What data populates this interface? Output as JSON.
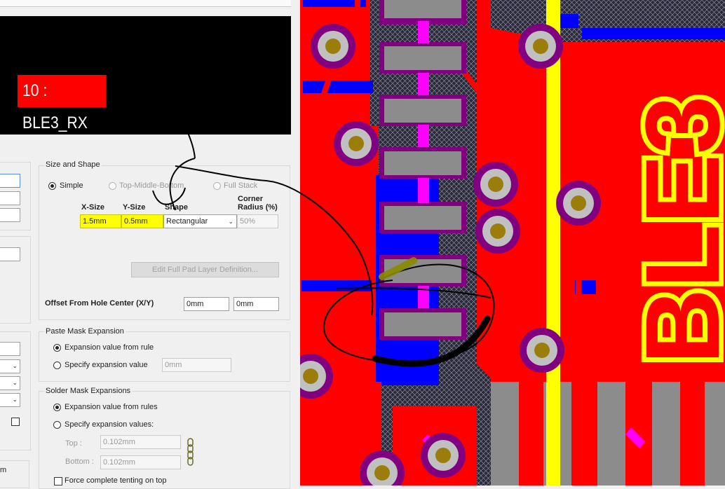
{
  "preview": {
    "pad_label": "10 : BLE3_RX"
  },
  "size_shape": {
    "title": "Size and Shape",
    "mode_simple": "Simple",
    "mode_tmb": "Top-Middle-Bottom",
    "mode_full": "Full Stack",
    "col_x": "X-Size",
    "col_y": "Y-Size",
    "col_shape": "Shape",
    "col_corner_1": "Corner",
    "col_corner_2": "Radius (%)",
    "x_size": "1.5mm",
    "y_size": "0.5mm",
    "shape": "Rectangular",
    "corner_radius": "50%",
    "edit_button": "Edit Full Pad Layer Definition...",
    "offset_label": "Offset From Hole Center (X/Y)",
    "offset_x": "0mm",
    "offset_y": "0mm"
  },
  "paste_mask": {
    "title": "Paste Mask Expansion",
    "opt_rule": "Expansion value from rule",
    "opt_specify": "Specify expansion value",
    "value": "0mm"
  },
  "solder_mask": {
    "title": "Solder Mask Expansions",
    "opt_rules": "Expansion value from rules",
    "opt_specify": "Specify expansion values:",
    "top_label": "Top :",
    "top_value": "0.102mm",
    "bottom_label": "Bottom :",
    "bottom_value": "0.102mm",
    "force_top": "Force complete tenting on top"
  },
  "left_fragment": {
    "label": "m"
  },
  "pcb": {
    "silk_text": "BLE3",
    "colors": {
      "top_copper": "#ff0000",
      "bottom_copper": "#0000ff",
      "pad_gray": "#8c8c8c",
      "silkscreen": "#ffff00",
      "solder_mask": "#800080",
      "via_ring": "#c0c0c0",
      "via_hole": "#9a7d0a",
      "magenta": "#ff00ff"
    }
  }
}
